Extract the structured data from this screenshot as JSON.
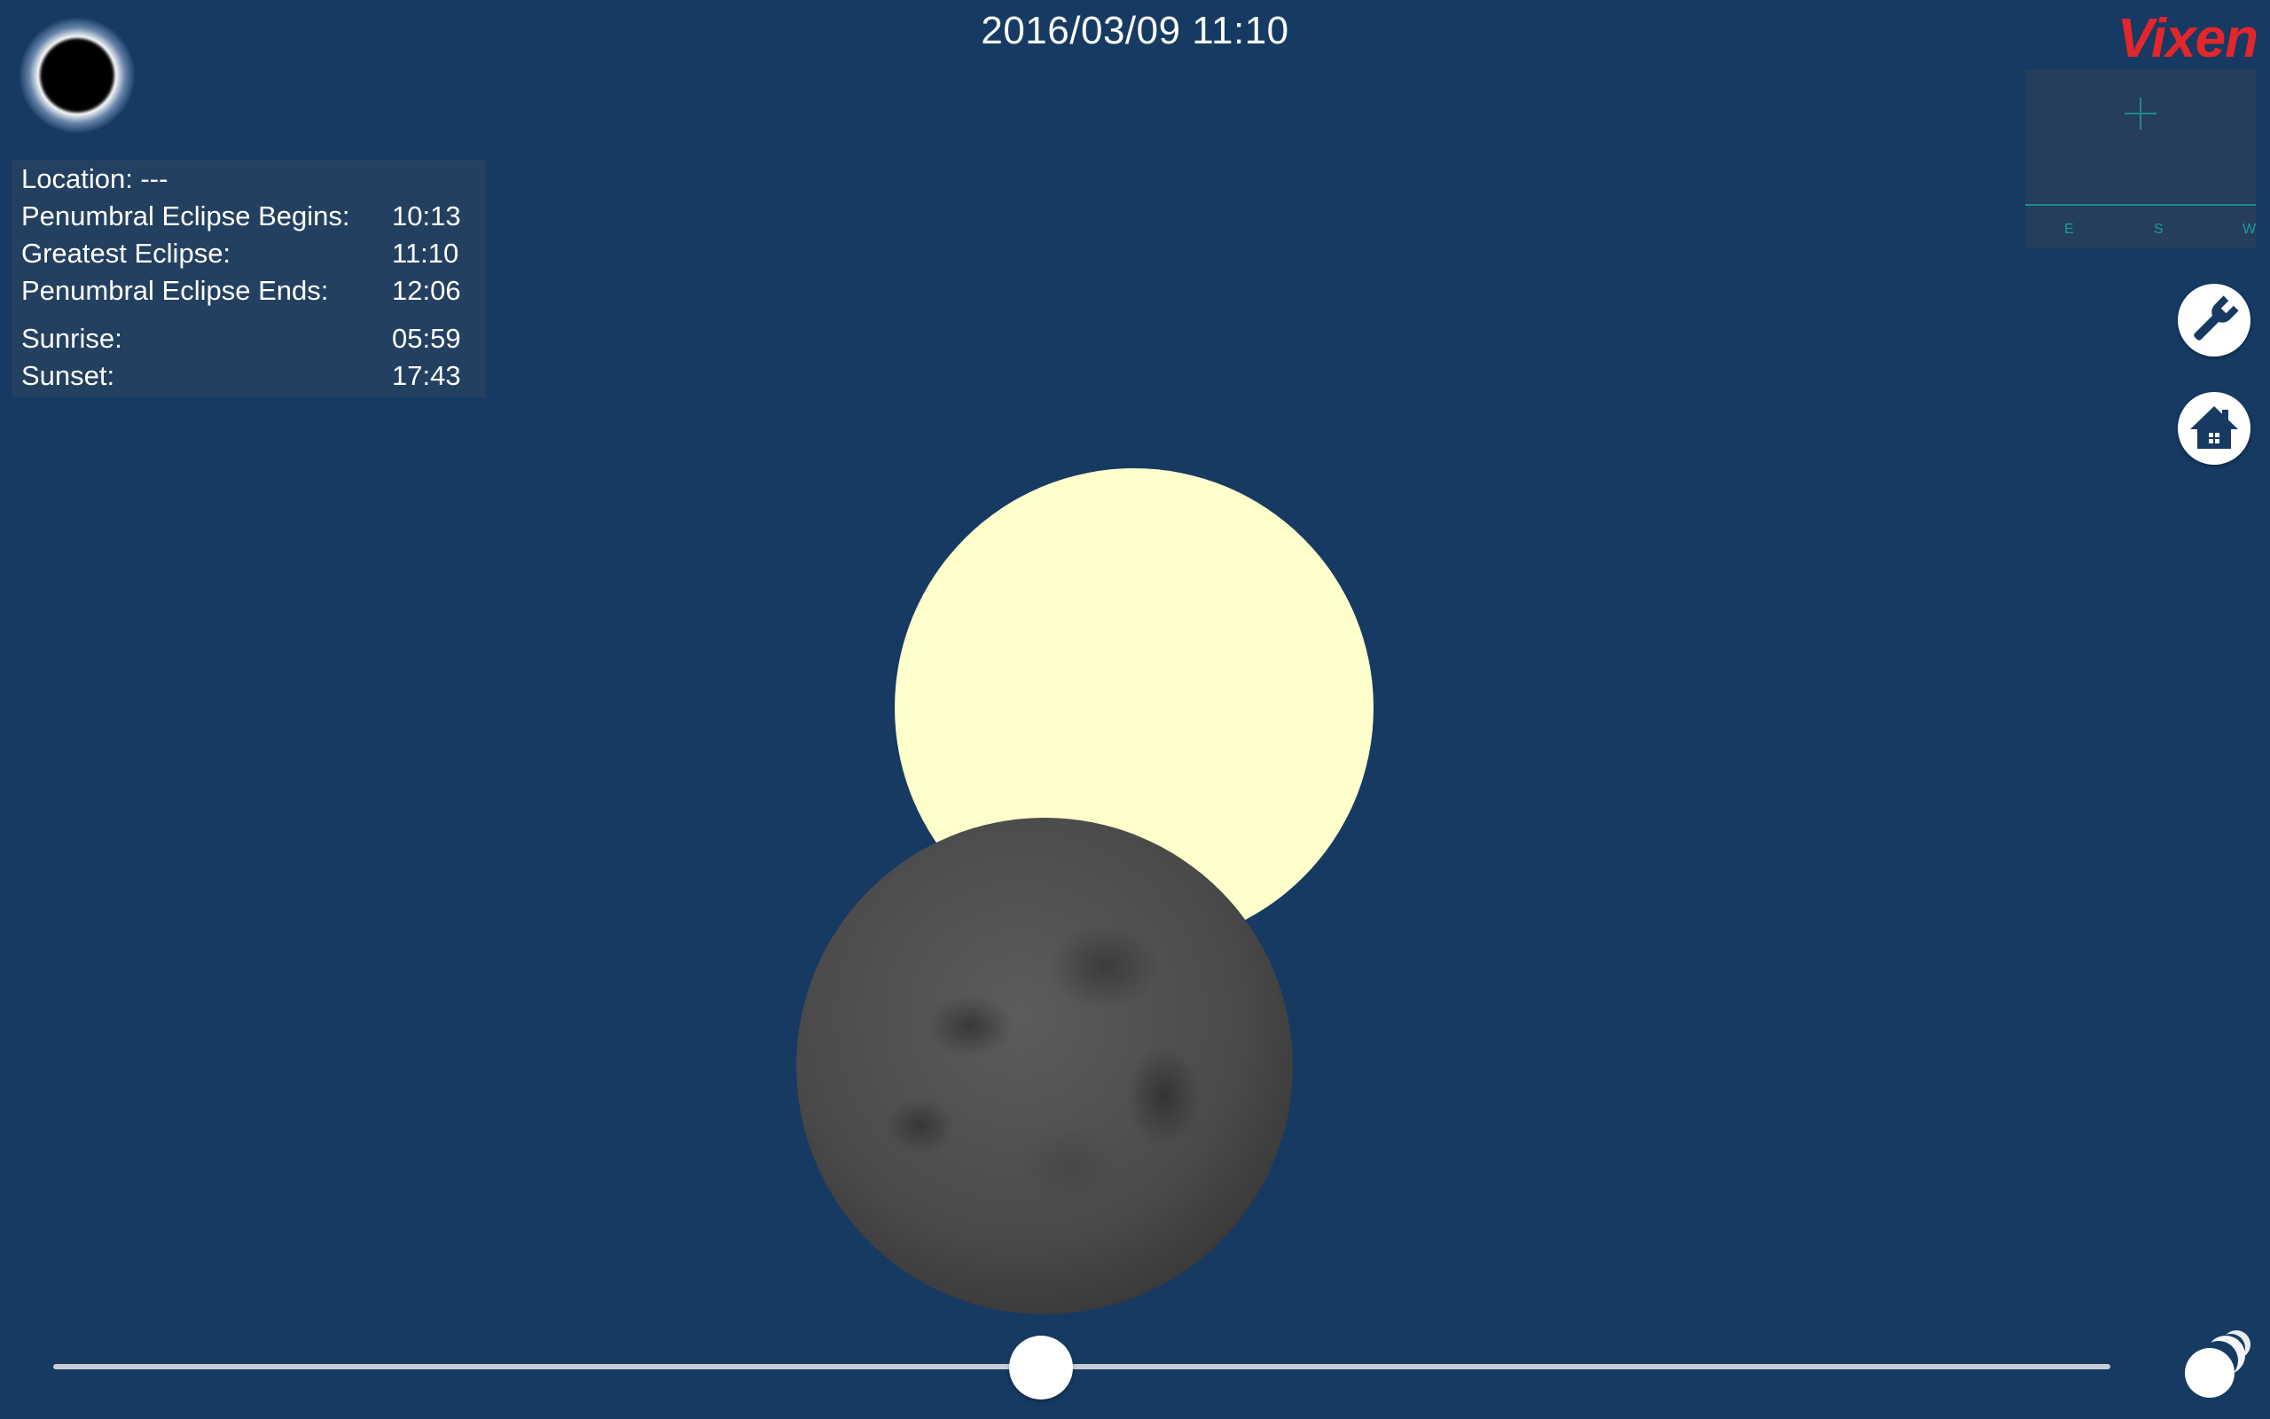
{
  "header": {
    "datetime": "2016/03/09 11:10"
  },
  "brand": {
    "logo_text": "Vixen",
    "logo_color": "#e3262b"
  },
  "info": {
    "location": "Location: ---",
    "rows": [
      {
        "label": "Penumbral Eclipse Begins:",
        "value": "10:13"
      },
      {
        "label": "Greatest Eclipse:",
        "value": "11:10"
      },
      {
        "label": "Penumbral Eclipse Ends:",
        "value": "12:06"
      },
      {
        "label": "Sunrise:",
        "value": "05:59"
      },
      {
        "label": "Sunset:",
        "value": "17:43"
      }
    ]
  },
  "sky_map": {
    "directions": [
      "E",
      "S",
      "W"
    ]
  },
  "icons": {
    "eclipse": "eclipse-icon",
    "settings": "wrench-icon",
    "home": "home-icon",
    "phases": "moon-phases-icon"
  },
  "colors": {
    "background": "#163a62",
    "sun": "#ffffcc",
    "accent": "#1e8a8f"
  },
  "timeline": {
    "progress": 0.48
  }
}
